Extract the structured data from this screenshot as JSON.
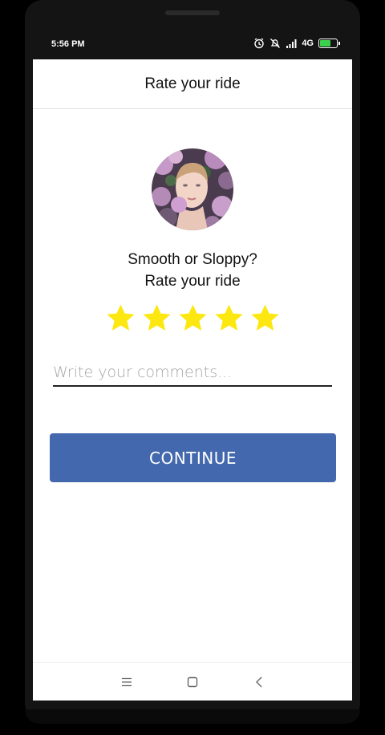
{
  "status_bar": {
    "time": "5:56 PM",
    "network": "4G",
    "icons": [
      "alarm-icon",
      "mute-icon",
      "signal-icon",
      "battery-charging-icon"
    ]
  },
  "header": {
    "title": "Rate your ride"
  },
  "driver": {
    "avatar_icon": "driver-avatar"
  },
  "prompt": {
    "line1": "Smooth or Sloppy?",
    "line2": "Rate your ride"
  },
  "rating": {
    "value": 5,
    "max": 5,
    "star_color": "#fce810"
  },
  "comment": {
    "value": "",
    "placeholder": "Write your comments..."
  },
  "continue_button": {
    "label": "CONTINUE",
    "color": "#4368ad"
  },
  "nav_bar": {
    "icons": [
      "menu-icon",
      "home-icon",
      "back-icon"
    ]
  }
}
